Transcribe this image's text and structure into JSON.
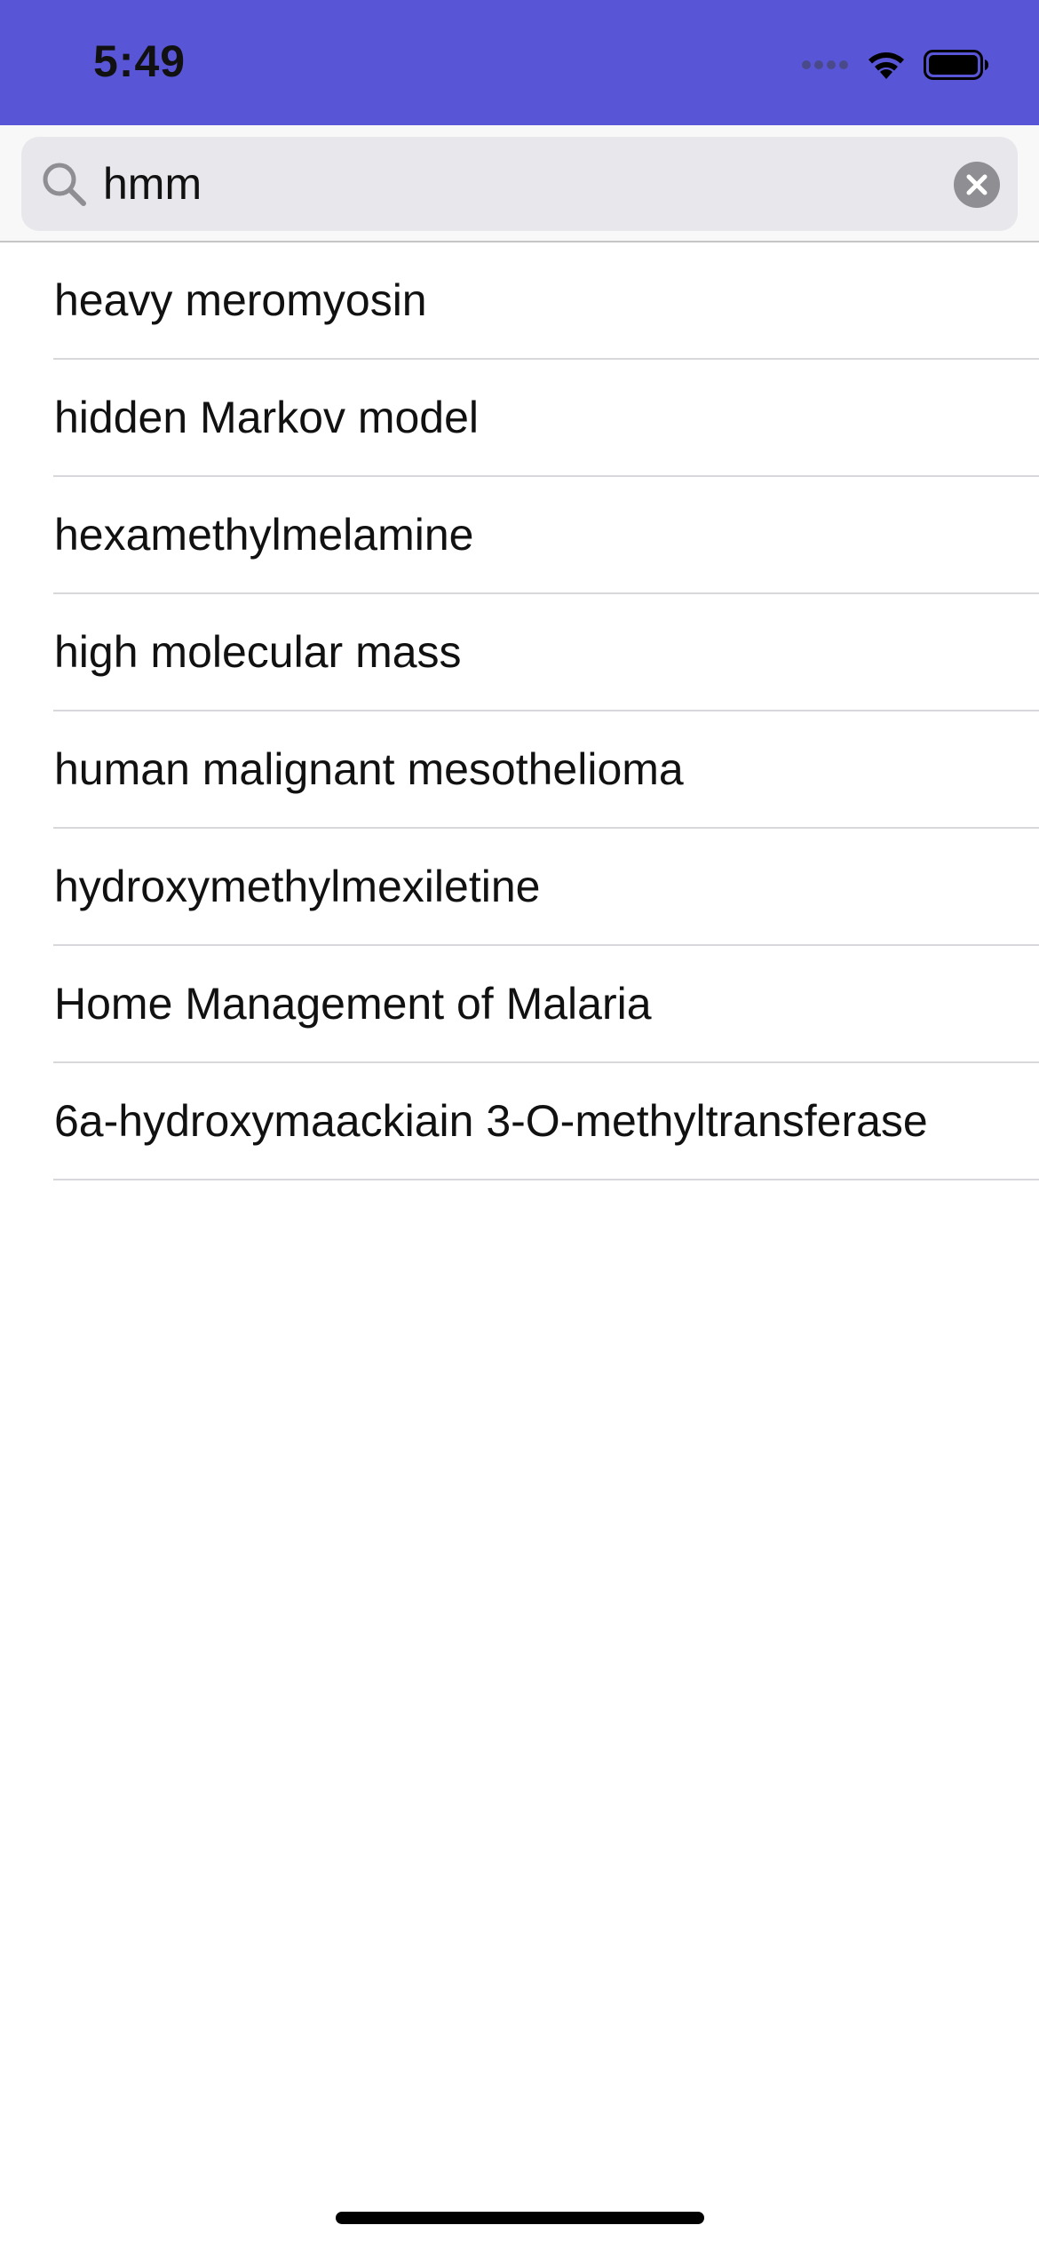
{
  "status_bar": {
    "time": "5:49",
    "background_color": "#5856d6",
    "icons": [
      "signal-dots-icon",
      "wifi-icon",
      "battery-icon"
    ]
  },
  "search": {
    "value": "hmm",
    "placeholder": "",
    "icons": [
      "search-icon",
      "clear-icon"
    ]
  },
  "results": [
    {
      "label": "heavy meromyosin"
    },
    {
      "label": "hidden Markov model"
    },
    {
      "label": "hexamethylmelamine"
    },
    {
      "label": "high molecular mass"
    },
    {
      "label": "human malignant mesothelioma"
    },
    {
      "label": "hydroxymethylmexiletine"
    },
    {
      "label": "Home Management of Malaria"
    },
    {
      "label": "6a-hydroxymaackiain 3-O-methyltransferase"
    }
  ]
}
